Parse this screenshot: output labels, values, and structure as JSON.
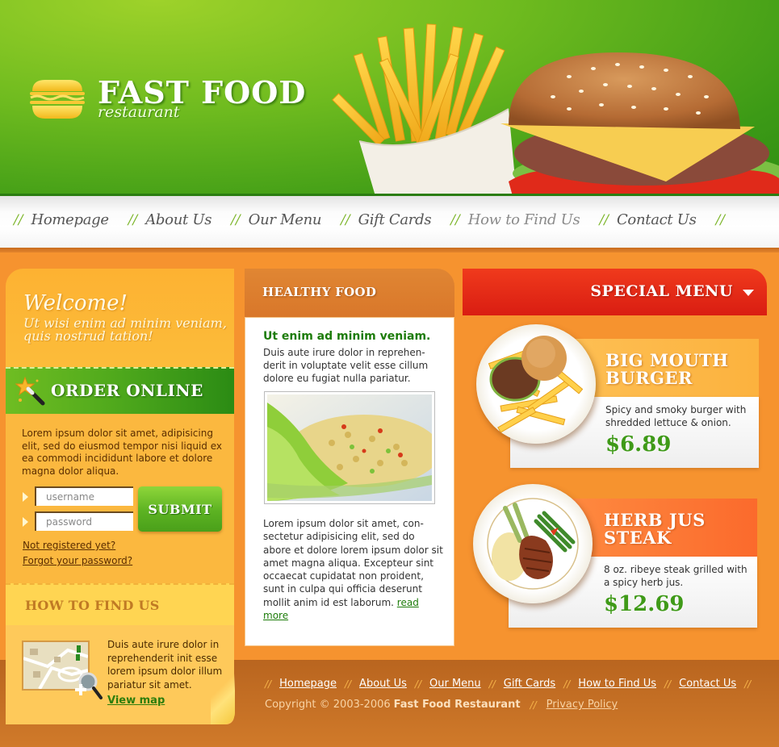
{
  "brand": {
    "title": "FAST FOOD",
    "subtitle": "restaurant"
  },
  "nav": {
    "separator": "//",
    "items": [
      {
        "label": "Homepage"
      },
      {
        "label": "About Us"
      },
      {
        "label": "Our Menu"
      },
      {
        "label": "Gift Cards"
      },
      {
        "label": "How to Find Us"
      },
      {
        "label": "Contact Us"
      }
    ]
  },
  "welcome": {
    "title": "Welcome!",
    "subtitle": "Ut wisi enim ad minim veniam, quis nostrud tation!"
  },
  "order": {
    "title": "ORDER ONLINE",
    "text": "Lorem ipsum dolor sit amet, adipisicing elit, sed do eiusmod tempor nisi liquid ex ea commodi  incididunt labore et dolore magna dolor aliqua.",
    "username_placeholder": "username",
    "password_placeholder": "password",
    "submit_label": "SUBMIT",
    "not_registered": "Not registered yet?",
    "forgot_password": "Forgot your password?"
  },
  "find_us": {
    "title": "HOW TO FIND US",
    "text": "Duis aute irure dolor in reprehenderit init esse lorem ipsum dolor illum pariatur sit amet.",
    "view_map": "View map"
  },
  "healthy": {
    "title": "HEALTHY FOOD",
    "lead": "Ut enim ad minim veniam.",
    "text": "Duis aute irure dolor in reprehen-derit in voluptate velit esse cillum dolore eu fugiat nulla pariatur.",
    "text2": "Lorem ipsum dolor sit amet, con-sectetur adipisicing elit, sed do abore et dolore lorem ipsum dolor sit amet magna aliqua. Excepteur sint occaecat cupidatat non proident, sunt in culpa qui officia deserunt mollit anim id est laborum.",
    "read_more": "read more"
  },
  "special": {
    "title": "SPECIAL MENU",
    "dishes": [
      {
        "name_line1": "BIG MOUTH",
        "name_line2": "BURGER",
        "description": "Spicy and smoky burger with shredded lettuce & onion.",
        "price": "$6.89",
        "accent": "#fcb23e"
      },
      {
        "name_line1": "HERB JUS",
        "name_line2": "STEAK",
        "description": "8 oz. ribeye steak grilled with a spicy herb jus.",
        "price": "$12.69",
        "accent": "#fb6a2c"
      }
    ]
  },
  "footer": {
    "separator": "//",
    "links": [
      {
        "label": "Homepage"
      },
      {
        "label": "About Us"
      },
      {
        "label": "Our Menu"
      },
      {
        "label": "Gift Cards"
      },
      {
        "label": "How to Find Us"
      },
      {
        "label": "Contact Us"
      }
    ],
    "copyright": "Copyright © 2003-2006",
    "company": "Fast Food Restaurant",
    "privacy": "Privacy Policy"
  },
  "colors": {
    "header_green": "#4ea81c",
    "accent_orange": "#f6932f",
    "special_red": "#e02a16",
    "price_green": "#3f9a18"
  }
}
